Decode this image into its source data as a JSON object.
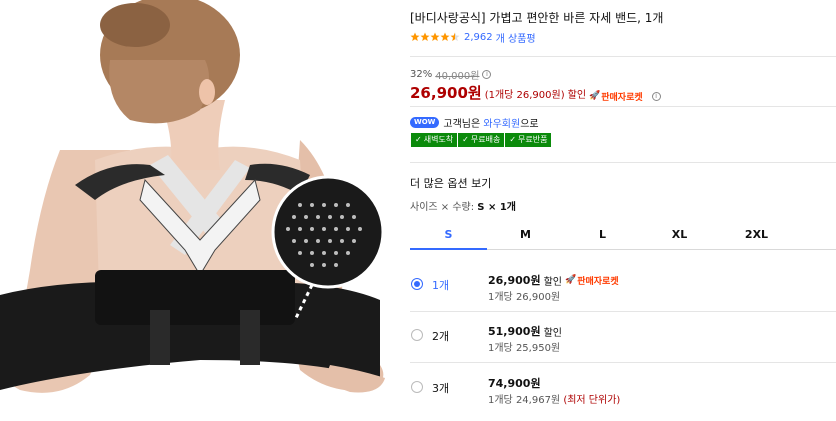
{
  "product": {
    "title": "[바디사랑공식] 가볍고 편안한 바른 자세 밴드, 1개",
    "rating": 4.5,
    "review_count": "2,962",
    "review_label": "개 상품평"
  },
  "pricing": {
    "discount_pct": "32%",
    "original_price": "40,000원",
    "sale_price": "26,900원",
    "unit_price": "(1개당 26,900원)",
    "discount_word": "할인",
    "rocket_label": "판매자로켓"
  },
  "wow": {
    "badge": "WOW",
    "text_prefix": "고객님은 ",
    "link": "와우회원",
    "text_suffix": "으로"
  },
  "delivery_badges": [
    "새벽도착",
    "무료배송",
    "무료반품"
  ],
  "options": {
    "heading": "더 많은 옵션 보기",
    "size_qty_prefix": "사이즈 × 수량: ",
    "size_qty_value": "S × 1개",
    "sizes": [
      "S",
      "M",
      "L",
      "XL",
      "2XL"
    ],
    "selected_size": "S"
  },
  "quantities": [
    {
      "label": "1개",
      "price": "26,900원",
      "word": "할인",
      "rocket": "판매자로켓",
      "unit": "1개당 26,900원",
      "note": "",
      "selected": true
    },
    {
      "label": "2개",
      "price": "51,900원",
      "word": "할인",
      "rocket": "",
      "unit": "1개당 25,950원",
      "note": "",
      "selected": false
    },
    {
      "label": "3개",
      "price": "74,900원",
      "word": "",
      "rocket": "",
      "unit": "1개당 24,967원",
      "note": "(최저 단위가)",
      "selected": false
    }
  ],
  "colors": {
    "accent": "#346aff",
    "price_red": "#ae0000",
    "delivery_green": "#0b8a0b",
    "rocket_orange": "#ff3b00"
  },
  "icons": {
    "info": "info-circle-icon",
    "star": "star-icon",
    "rocket": "rocket-icon",
    "check": "check-icon"
  }
}
